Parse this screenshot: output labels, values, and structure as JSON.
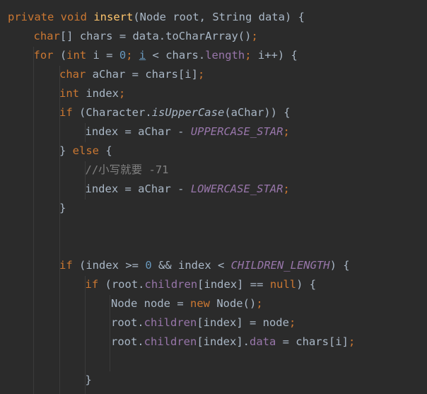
{
  "code_lines": [
    {
      "indent": 0,
      "tokens": [
        {
          "t": "private",
          "c": "kw"
        },
        {
          "t": " "
        },
        {
          "t": "void",
          "c": "kw"
        },
        {
          "t": " "
        },
        {
          "t": "insert",
          "c": "fn"
        },
        {
          "t": "(Node root, String data) {"
        }
      ]
    },
    {
      "indent": 1,
      "tokens": [
        {
          "t": "char",
          "c": "kw"
        },
        {
          "t": "[] chars = data.toCharArray()"
        },
        {
          "t": ";",
          "c": "kw"
        }
      ]
    },
    {
      "indent": 1,
      "tokens": [
        {
          "t": "for",
          "c": "kw"
        },
        {
          "t": " ("
        },
        {
          "t": "int",
          "c": "kw"
        },
        {
          "t": " i = "
        },
        {
          "t": "0",
          "c": "num"
        },
        {
          "t": "; ",
          "c": "kw"
        },
        {
          "t": "i",
          "c": "num underline"
        },
        {
          "t": " < chars."
        },
        {
          "t": "length",
          "c": "field"
        },
        {
          "t": "; ",
          "c": "kw"
        },
        {
          "t": "i++) {"
        }
      ]
    },
    {
      "indent": 2,
      "tokens": [
        {
          "t": "char",
          "c": "kw"
        },
        {
          "t": " aChar = chars[i]"
        },
        {
          "t": ";",
          "c": "kw"
        }
      ]
    },
    {
      "indent": 2,
      "tokens": [
        {
          "t": "int",
          "c": "kw"
        },
        {
          "t": " index"
        },
        {
          "t": ";",
          "c": "kw"
        }
      ]
    },
    {
      "indent": 2,
      "tokens": [
        {
          "t": "if",
          "c": "kw"
        },
        {
          "t": " (Character."
        },
        {
          "t": "isUpperCase",
          "c": "static"
        },
        {
          "t": "(aChar)) {"
        }
      ]
    },
    {
      "indent": 3,
      "tokens": [
        {
          "t": "index = aChar - "
        },
        {
          "t": "UPPERCASE_STAR",
          "c": "const"
        },
        {
          "t": ";",
          "c": "kw"
        }
      ]
    },
    {
      "indent": 2,
      "tokens": [
        {
          "t": "} "
        },
        {
          "t": "else",
          "c": "kw"
        },
        {
          "t": " {"
        }
      ]
    },
    {
      "indent": 3,
      "tokens": [
        {
          "t": "//小写就要 -71",
          "c": "comment"
        }
      ]
    },
    {
      "indent": 3,
      "tokens": [
        {
          "t": "index = aChar - "
        },
        {
          "t": "LOWERCASE_STAR",
          "c": "const"
        },
        {
          "t": ";",
          "c": "kw"
        }
      ]
    },
    {
      "indent": 2,
      "tokens": [
        {
          "t": "}"
        }
      ]
    },
    {
      "indent": 0,
      "tokens": []
    },
    {
      "indent": 0,
      "tokens": []
    },
    {
      "indent": 2,
      "tokens": [
        {
          "t": "if",
          "c": "kw"
        },
        {
          "t": " (index >= "
        },
        {
          "t": "0",
          "c": "num"
        },
        {
          "t": " && index < "
        },
        {
          "t": "CHILDREN_LENGTH",
          "c": "const"
        },
        {
          "t": ") {"
        }
      ]
    },
    {
      "indent": 3,
      "tokens": [
        {
          "t": "if",
          "c": "kw"
        },
        {
          "t": " (root."
        },
        {
          "t": "children",
          "c": "field"
        },
        {
          "t": "[index] == "
        },
        {
          "t": "null",
          "c": "kw"
        },
        {
          "t": ") {"
        }
      ]
    },
    {
      "indent": 4,
      "tokens": [
        {
          "t": "Node node = "
        },
        {
          "t": "new",
          "c": "kw"
        },
        {
          "t": " Node()"
        },
        {
          "t": ";",
          "c": "kw"
        }
      ]
    },
    {
      "indent": 4,
      "tokens": [
        {
          "t": "root."
        },
        {
          "t": "children",
          "c": "field"
        },
        {
          "t": "[index] = node"
        },
        {
          "t": ";",
          "c": "kw"
        }
      ]
    },
    {
      "indent": 4,
      "tokens": [
        {
          "t": "root."
        },
        {
          "t": "children",
          "c": "field"
        },
        {
          "t": "[index]."
        },
        {
          "t": "data",
          "c": "field"
        },
        {
          "t": " = chars[i]"
        },
        {
          "t": ";",
          "c": "kw"
        }
      ]
    },
    {
      "indent": 0,
      "tokens": []
    },
    {
      "indent": 3,
      "tokens": [
        {
          "t": "}"
        }
      ]
    }
  ],
  "colors": {
    "background": "#2b2b2b",
    "keyword": "#cc7832",
    "function": "#ffc66d",
    "number": "#6897bb",
    "field": "#9876aa",
    "comment": "#808080",
    "text": "#a9b7c6"
  }
}
